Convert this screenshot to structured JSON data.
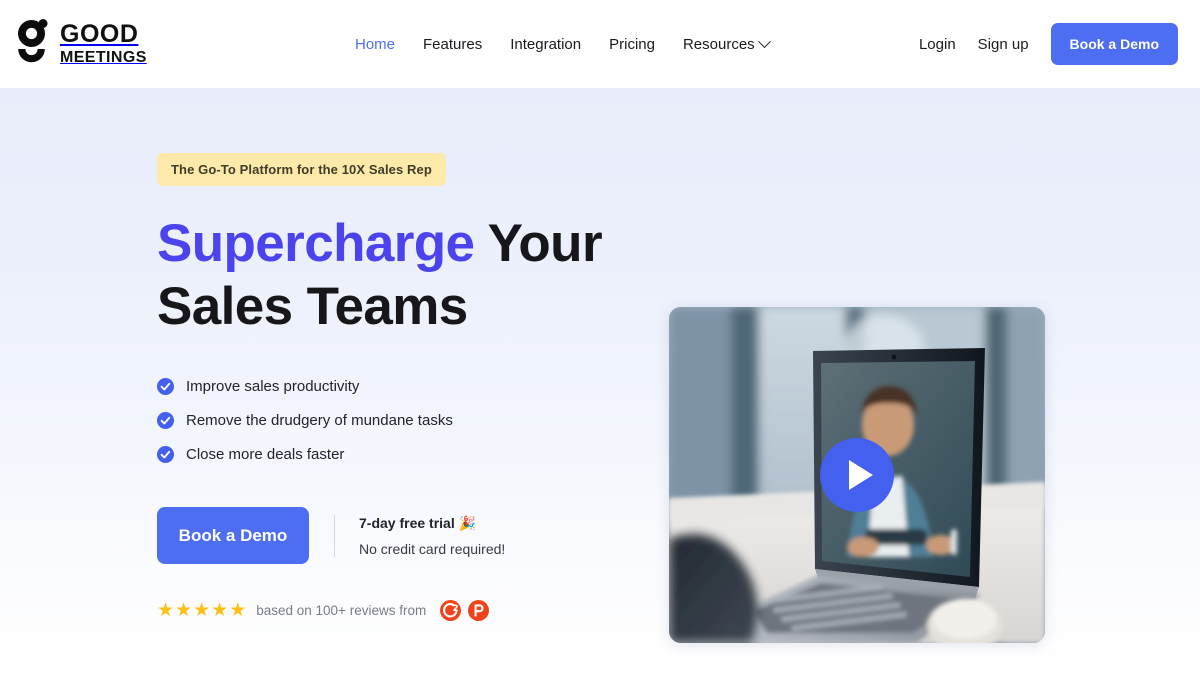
{
  "brand": {
    "logo_line1": "GOOD",
    "logo_line2": "MEETINGS",
    "logo_icon": "goodmeetings-g-icon",
    "accent_color": "#4e6ef2",
    "headline_accent_color": "#4a43ee",
    "badge_color": "#fde9a9",
    "star_color": "#fbbf16",
    "review_badge_color": "#f0421b"
  },
  "nav": {
    "items": [
      {
        "label": "Home",
        "active": true,
        "has_chevron": false
      },
      {
        "label": "Features",
        "active": false,
        "has_chevron": false
      },
      {
        "label": "Integration",
        "active": false,
        "has_chevron": false
      },
      {
        "label": "Pricing",
        "active": false,
        "has_chevron": false
      },
      {
        "label": "Resources",
        "active": false,
        "has_chevron": true
      }
    ],
    "login_label": "Login",
    "signup_label": "Sign up",
    "demo_button_label": "Book a Demo"
  },
  "hero": {
    "badge": "The Go-To Platform for the 10X Sales Rep",
    "headline_accent": "Supercharge",
    "headline_rest": " Your",
    "headline_line2": "Sales Teams",
    "bullets": [
      {
        "label": "Improve sales productivity",
        "icon": "check-circle-icon"
      },
      {
        "label": "Remove the drudgery of mundane tasks",
        "icon": "check-circle-icon"
      },
      {
        "label": "Close more deals faster",
        "icon": "check-circle-icon"
      }
    ],
    "cta_button_label": "Book a Demo",
    "trial_title": "7-day free trial 🎉",
    "trial_subtitle": "No credit card required!",
    "reviews": {
      "star_count": 5,
      "text": "based on 100+ reviews from",
      "platforms": [
        {
          "name": "g2-badge",
          "letter": "G"
        },
        {
          "name": "product-hunt-badge",
          "letter": "P"
        }
      ]
    }
  },
  "video": {
    "alt": "Laptop on a desk showing a video call with a person on screen",
    "play_label": "play-button"
  }
}
